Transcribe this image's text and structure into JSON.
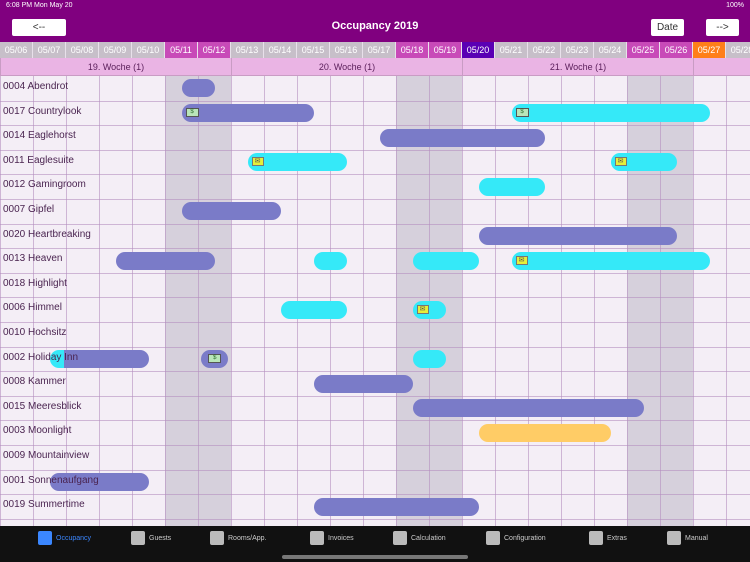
{
  "status": {
    "time": "6:08 PM",
    "day": "Mon May 20",
    "battery": "100%"
  },
  "header": {
    "title": "Occupancy 2019",
    "prev_label": "<--",
    "date_label": "Date",
    "next_label": "-->"
  },
  "colors": {
    "header": "#80007f",
    "today": "#5a00b4",
    "weekend": "#c84ab8",
    "highlight": "#ff7f1a",
    "booking_confirmed": "#7a7bc8",
    "booking_request": "#35e9f8",
    "booking_option": "#ffcc66"
  },
  "dates": [
    {
      "label": "05/06",
      "type": "normal"
    },
    {
      "label": "05/07",
      "type": "normal"
    },
    {
      "label": "05/08",
      "type": "normal"
    },
    {
      "label": "05/09",
      "type": "normal"
    },
    {
      "label": "05/10",
      "type": "normal"
    },
    {
      "label": "05/11",
      "type": "weekend"
    },
    {
      "label": "05/12",
      "type": "weekend"
    },
    {
      "label": "05/13",
      "type": "normal"
    },
    {
      "label": "05/14",
      "type": "normal"
    },
    {
      "label": "05/15",
      "type": "normal"
    },
    {
      "label": "05/16",
      "type": "normal"
    },
    {
      "label": "05/17",
      "type": "normal"
    },
    {
      "label": "05/18",
      "type": "weekend"
    },
    {
      "label": "05/19",
      "type": "weekend"
    },
    {
      "label": "05/20",
      "type": "today"
    },
    {
      "label": "05/21",
      "type": "normal"
    },
    {
      "label": "05/22",
      "type": "normal"
    },
    {
      "label": "05/23",
      "type": "normal"
    },
    {
      "label": "05/24",
      "type": "normal"
    },
    {
      "label": "05/25",
      "type": "weekend"
    },
    {
      "label": "05/26",
      "type": "weekend"
    },
    {
      "label": "05/27",
      "type": "highlight"
    },
    {
      "label": "05/28",
      "type": "normal"
    }
  ],
  "weeks": [
    {
      "label": "19. Woche (1)",
      "start": 0,
      "days": 7
    },
    {
      "label": "20. Woche (1)",
      "start": 7,
      "days": 7
    },
    {
      "label": "21. Woche (1)",
      "start": 14,
      "days": 7
    },
    {
      "label": "",
      "start": 21,
      "days": 2
    }
  ],
  "rooms": [
    {
      "label": "0004 Abendrot",
      "bookings": [
        {
          "start": 5.5,
          "end": 6.5,
          "color": "purple"
        }
      ]
    },
    {
      "label": "0017 Countrylook",
      "bookings": [
        {
          "start": 5.5,
          "end": 9.5,
          "color": "purple",
          "icon": "money"
        },
        {
          "start": 15.5,
          "end": 21.5,
          "color": "cyan",
          "icon": "money"
        }
      ]
    },
    {
      "label": "0014 Eaglehorst",
      "bookings": [
        {
          "start": 11.5,
          "end": 16.5,
          "color": "purple"
        }
      ]
    },
    {
      "label": "0011 Eaglesuite",
      "bookings": [
        {
          "start": 7.5,
          "end": 10.5,
          "color": "cyan",
          "icon": "envelope"
        },
        {
          "start": 18.5,
          "end": 20.5,
          "color": "cyan",
          "icon": "envelope"
        }
      ]
    },
    {
      "label": "0012 Gamingroom",
      "bookings": [
        {
          "start": 14.5,
          "end": 16.5,
          "color": "cyan"
        }
      ]
    },
    {
      "label": "0007 Gipfel",
      "bookings": [
        {
          "start": 5.5,
          "end": 8.5,
          "color": "purple"
        }
      ]
    },
    {
      "label": "0020 Heartbreaking",
      "bookings": [
        {
          "start": 14.5,
          "end": 20.5,
          "color": "purple"
        }
      ]
    },
    {
      "label": "0013 Heaven",
      "bookings": [
        {
          "start": 3.5,
          "end": 6.5,
          "color": "purple"
        },
        {
          "start": 9.5,
          "end": 10.5,
          "color": "cyan"
        },
        {
          "start": 12.5,
          "end": 14.5,
          "color": "cyan"
        },
        {
          "start": 15.5,
          "end": 21.5,
          "color": "cyan",
          "icon": "envelope"
        }
      ]
    },
    {
      "label": "0018 Highlight",
      "bookings": []
    },
    {
      "label": "0006 Himmel",
      "bookings": [
        {
          "start": 8.5,
          "end": 10.5,
          "color": "cyan"
        },
        {
          "start": 12.5,
          "end": 13.5,
          "color": "cyan",
          "icon": "envelope"
        }
      ]
    },
    {
      "label": "0010 Hochsitz",
      "bookings": []
    },
    {
      "label": "0002 Holiday Inn",
      "bookings": [
        {
          "start": 1.5,
          "end": 4.5,
          "color": "purple",
          "cyanstart": true
        },
        {
          "start": 6.1,
          "end": 6.9,
          "color": "purple",
          "icon": "money"
        },
        {
          "start": 12.5,
          "end": 13.5,
          "color": "cyan"
        }
      ]
    },
    {
      "label": "0008 Kammer",
      "bookings": [
        {
          "start": 9.5,
          "end": 12.5,
          "color": "purple"
        }
      ]
    },
    {
      "label": "0015 Meeresblick",
      "bookings": [
        {
          "start": 12.5,
          "end": 19.5,
          "color": "purple"
        }
      ]
    },
    {
      "label": "0003 Moonlight",
      "bookings": [
        {
          "start": 14.5,
          "end": 18.5,
          "color": "orange"
        }
      ]
    },
    {
      "label": "0009 Mountainview",
      "bookings": []
    },
    {
      "label": "0001 Sonnenaufgang",
      "bookings": [
        {
          "start": 1.5,
          "end": 4.5,
          "color": "purple"
        }
      ]
    },
    {
      "label": "0019 Summertime",
      "bookings": [
        {
          "start": 9.5,
          "end": 14.5,
          "color": "purple"
        }
      ]
    }
  ],
  "tabs": [
    {
      "label": "Occupancy",
      "icon": "calendar-icon",
      "active": true
    },
    {
      "label": "Guests",
      "icon": "guests-icon",
      "active": false
    },
    {
      "label": "Rooms/App.",
      "icon": "bed-icon",
      "active": false
    },
    {
      "label": "Invoices",
      "icon": "invoice-icon",
      "active": false
    },
    {
      "label": "Calculation",
      "icon": "calculator-icon",
      "active": false
    },
    {
      "label": "Configuration",
      "icon": "hammer-icon",
      "active": false
    },
    {
      "label": "Extras",
      "icon": "extras-icon",
      "active": false
    },
    {
      "label": "Manual",
      "icon": "help-icon",
      "active": false
    }
  ]
}
